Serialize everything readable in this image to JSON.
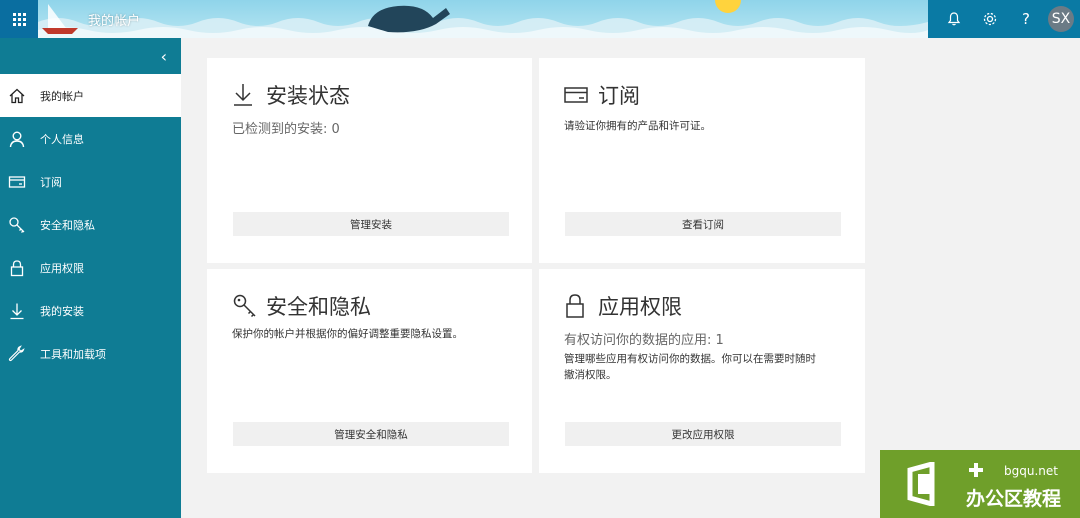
{
  "topbar": {
    "app_title": "我的帐户",
    "user_initials": "SX",
    "icons": [
      "app-launcher-icon",
      "bell-icon",
      "gear-icon",
      "help-icon"
    ],
    "help_glyph": "?"
  },
  "sidebar": {
    "collapse_glyph": "‹",
    "items": [
      {
        "label": "我的帐户",
        "icon": "home-icon",
        "active": true
      },
      {
        "label": "个人信息",
        "icon": "person-icon"
      },
      {
        "label": "订阅",
        "icon": "card-icon"
      },
      {
        "label": "安全和隐私",
        "icon": "key-icon"
      },
      {
        "label": "应用权限",
        "icon": "lock-icon"
      },
      {
        "label": "我的安装",
        "icon": "download-icon"
      },
      {
        "label": "工具和加载项",
        "icon": "wrench-icon"
      }
    ]
  },
  "cards": {
    "install": {
      "title": "安装状态",
      "subtitle": "已检测到的安装: 0",
      "button": "管理安装"
    },
    "subscription": {
      "title": "订阅",
      "description": "请验证你拥有的产品和许可证。",
      "button": "查看订阅"
    },
    "security": {
      "title": "安全和隐私",
      "description": "保护你的帐户并根据你的偏好调整重要隐私设置。",
      "button": "管理安全和隐私"
    },
    "permissions": {
      "title": "应用权限",
      "subtitle": "有权访问你的数据的应用: 1",
      "description_line1": "管理哪些应用有权访问你的数据。你可以在需要时随时",
      "description_line2": "撤消权限。",
      "button": "更改应用权限"
    }
  },
  "watermark": {
    "url": "bgqu.net",
    "name": "办公区教程"
  },
  "colors": {
    "sidebar": "#0f7c94",
    "topbar": "#0078a8",
    "watermark": "#6f9f2a"
  }
}
